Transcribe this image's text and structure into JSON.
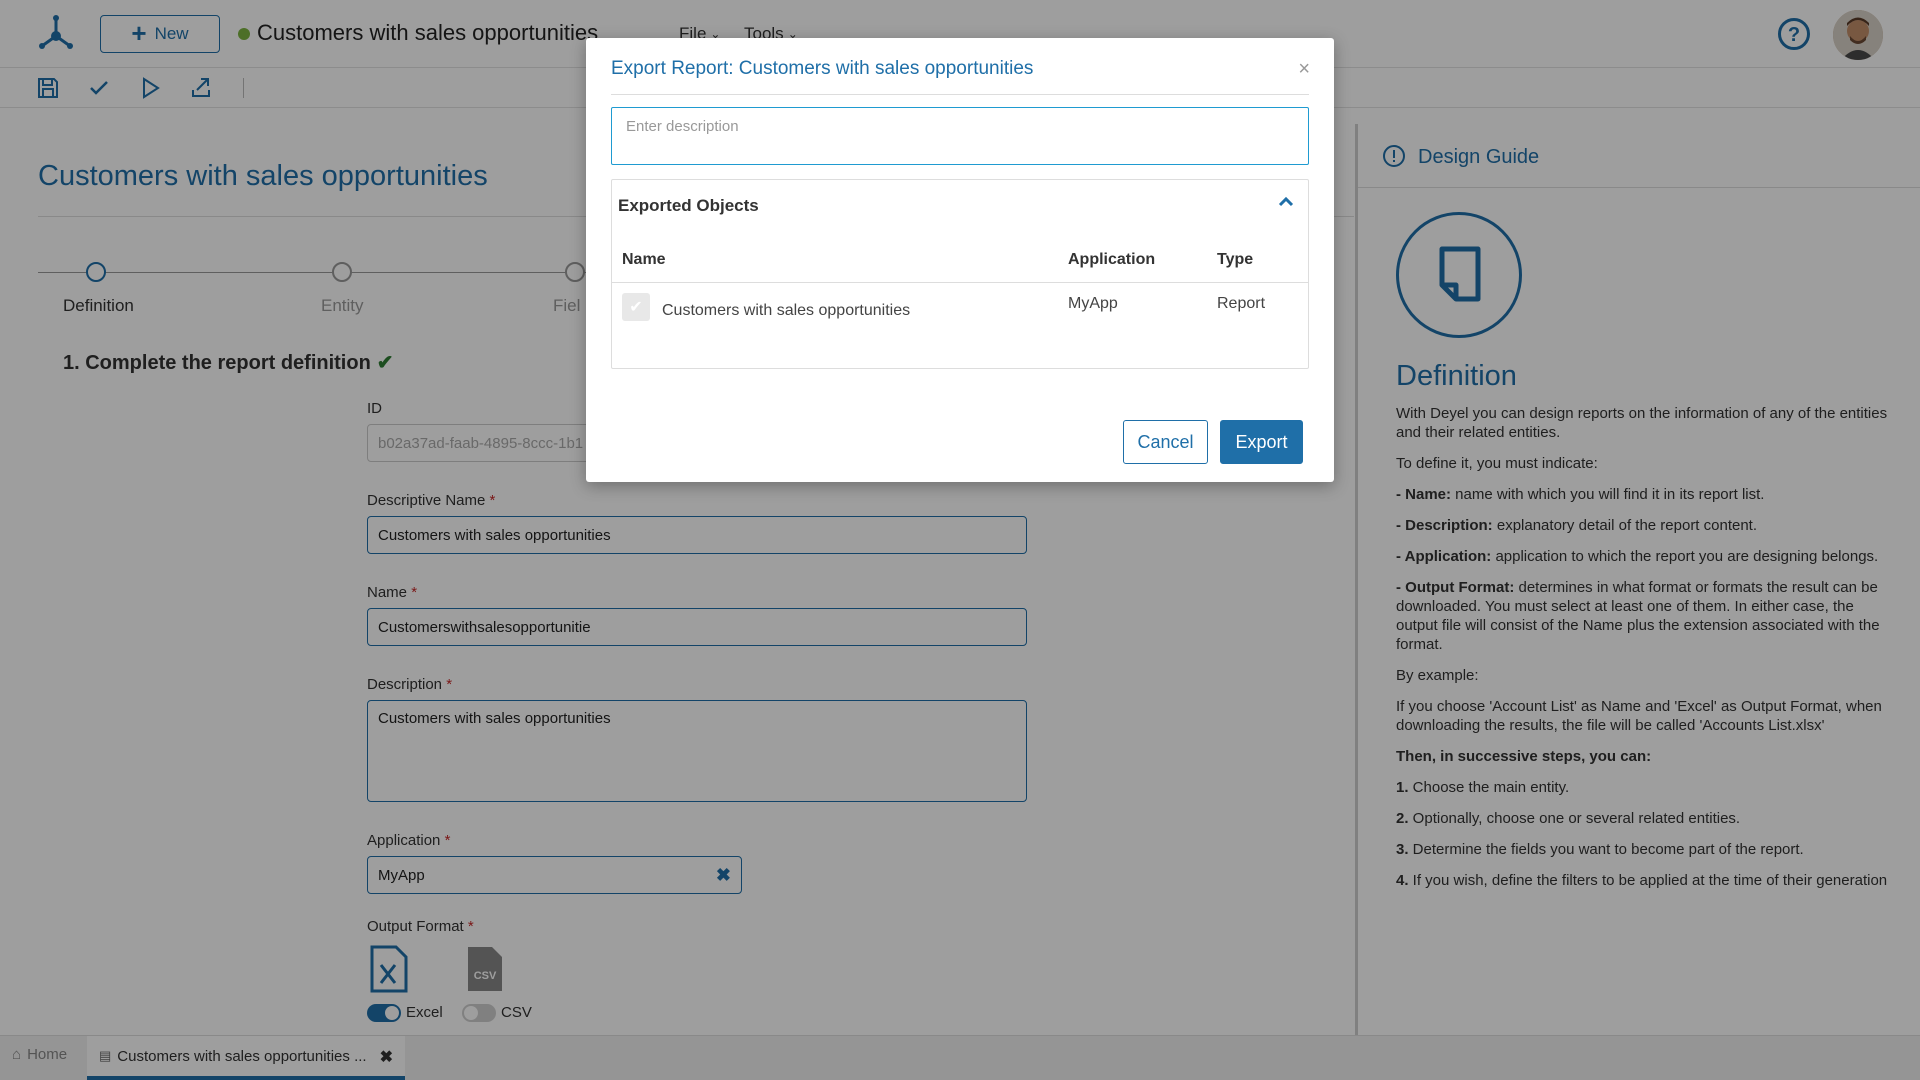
{
  "app": {
    "new_label": "New",
    "doc_title": "Customers with sales opportunities",
    "menu_file": "File",
    "menu_tools": "Tools"
  },
  "page": {
    "title": "Customers with sales opportunities",
    "steps": [
      "Definition",
      "Entity",
      "Fiel"
    ],
    "section_title": "1. Complete the report definition",
    "fields": {
      "id_label": "ID",
      "id_value": "b02a37ad-faab-4895-8ccc-1b1",
      "descriptive_name_label": "Descriptive Name",
      "descriptive_name_value": "Customers with sales opportunities",
      "name_label": "Name",
      "name_value": "Customerswithsalesopportunitie",
      "description_label": "Description",
      "description_value": "Customers with sales opportunities",
      "application_label": "Application",
      "application_value": "MyApp",
      "output_format_label": "Output Format",
      "required_mark": "*"
    },
    "formats": [
      {
        "label": "Excel",
        "enabled": true
      },
      {
        "label": "CSV",
        "enabled": false
      }
    ]
  },
  "guide": {
    "header": "Design Guide",
    "title": "Definition",
    "intro": "With Deyel you can design reports on the information of any of the entities and their related entities.",
    "to_define": "To define it, you must indicate:",
    "items": [
      {
        "term": "- Name:",
        "text": " name with which you will find it in its report list."
      },
      {
        "term": "- Description:",
        "text": " explanatory detail of the report content."
      },
      {
        "term": "- Application:",
        "text": " application to which the report you are designing belongs."
      },
      {
        "term": "- Output Format:",
        "text": " determines in what format or formats the result can be downloaded. You must select at least one of them. In either case, the output file will consist of the Name plus the extension associated with the format."
      }
    ],
    "by_example": "By example:",
    "example": "If you choose 'Account List' as Name and 'Excel' as Output Format, when downloading the results, the file will be called 'Accounts List.xlsx'",
    "then": "Then, in successive steps, you can:",
    "steps": [
      {
        "num": "1.",
        "text": " Choose the main entity."
      },
      {
        "num": "2.",
        "text": " Optionally, choose one or several related entities."
      },
      {
        "num": "3.",
        "text": " Determine the fields you want to become part of the report."
      },
      {
        "num": "4.",
        "text": " If you wish, define the filters to be applied at the time of their generation"
      }
    ]
  },
  "tabs": {
    "home": "Home",
    "active": "Customers with sales opportunities ..."
  },
  "modal": {
    "title": "Export Report: Customers with sales opportunities",
    "close": "×",
    "description_placeholder": "Enter description",
    "objects_title": "Exported Objects",
    "columns": [
      "Name",
      "Application",
      "Type"
    ],
    "rows": [
      {
        "name": "Customers with sales opportunities",
        "application": "MyApp",
        "type": "Report"
      }
    ],
    "cancel": "Cancel",
    "export": "Export"
  },
  "colors": {
    "accent": "#1f6fa8",
    "status_dot": "#7cb342",
    "check": "#2e7d32",
    "required": "#c62828"
  }
}
